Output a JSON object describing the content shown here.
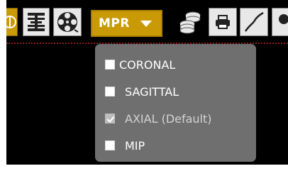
{
  "toolbar": {
    "mpr_label": "MPR",
    "icons": [
      "window-level-icon",
      "layout-icon",
      "cine-reel-icon",
      "coins-stack-icon",
      "print-icon",
      "curve-tool-icon",
      "circle-tool-icon"
    ]
  },
  "menu": {
    "items": [
      {
        "label": "CORONAL",
        "checked": false
      },
      {
        "label": "SAGITTAL",
        "checked": false
      },
      {
        "label": "AXIAL (Default)",
        "checked": true
      },
      {
        "label": "MIP",
        "checked": false
      }
    ]
  },
  "colors": {
    "mpr_button": "#c99a06",
    "menu_background": "#6f6f6f",
    "separator": "#8a1f1f"
  }
}
